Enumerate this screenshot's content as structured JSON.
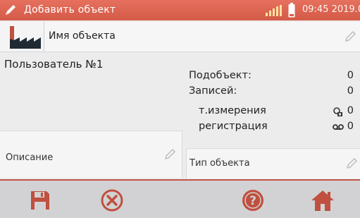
{
  "colors": {
    "accent": "#d4604d",
    "icon": "#c0503f",
    "text": "#222222",
    "background": "#ececed"
  },
  "statusbar": {
    "title": "Добавить объект",
    "time_date": "09:45 2019.02.11",
    "icons": [
      "edit-icon",
      "signal-icon",
      "battery-icon"
    ]
  },
  "object": {
    "name_label": "Имя объекта",
    "icon": "factory-icon"
  },
  "user": {
    "title": "Пользователь №1"
  },
  "stats": {
    "subobjects_label": "Подобъект:",
    "subobjects_value": "0",
    "records_label": "Записей:",
    "records_value": "0",
    "measure_label": "т.измерения",
    "measure_value": "0",
    "registration_label": "регистрация",
    "registration_value": "0"
  },
  "fields": {
    "description_label": "Описание",
    "type_label": "Тип объекта"
  },
  "toolbar": {
    "buttons": [
      "save-icon",
      "cancel-icon",
      "help-icon",
      "home-icon"
    ]
  }
}
